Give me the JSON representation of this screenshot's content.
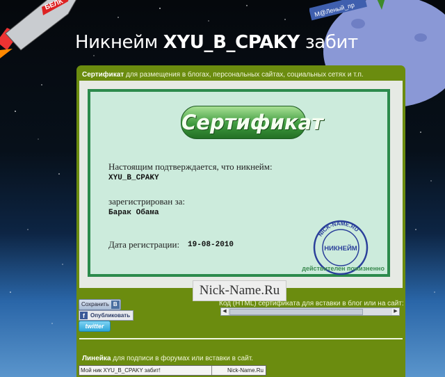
{
  "page_title": {
    "prefix": "Никнейм",
    "nickname": "XYU_B_CPAKY",
    "suffix": "забит"
  },
  "decor": {
    "rocket_text": "БЕЛК",
    "planet_sign": "М@Леный_пр"
  },
  "certificate": {
    "heading_bold": "Сертификат",
    "heading_rest": "для размещения в блогах, персональных сайтах, социальных сетях и т.п.",
    "banner": "Сертификат",
    "confirm_text": "Настоящим подтверждается, что никнейм:",
    "nickname": "XYU_B_CPAKY",
    "registered_for_label": "зарегистрирован за:",
    "registered_for": "Барак Обама",
    "date_label": "Дата регистрации:",
    "date": "19-08-2010",
    "stamp_text": "НИКНЕЙМ",
    "stamp_ring": "NICK-NAME.RU",
    "valid_note": "действителен пожизненно",
    "site_logo": "Nick-Name.Ru"
  },
  "share": {
    "save_label": "Сохранить",
    "vk_icon": "В",
    "fb_label": "Опубликовать",
    "fb_icon": "f",
    "twitter_label": "twitter"
  },
  "code": {
    "label": "Код (HTML) сертификата для вставки в блог или на сайт:"
  },
  "line": {
    "heading_bold": "Линейка",
    "heading_rest": "для подписи в форумах или вставки в сайт.",
    "left_text": "Мой ник XYU_B_CPAKY забит!",
    "right_text": "Nick-Name.Ru"
  },
  "colors": {
    "panel": "#6b8c0f",
    "certificate_border": "#2c8a4c",
    "certificate_fill": "#ccebdc",
    "stamp": "#2a3f9a"
  }
}
